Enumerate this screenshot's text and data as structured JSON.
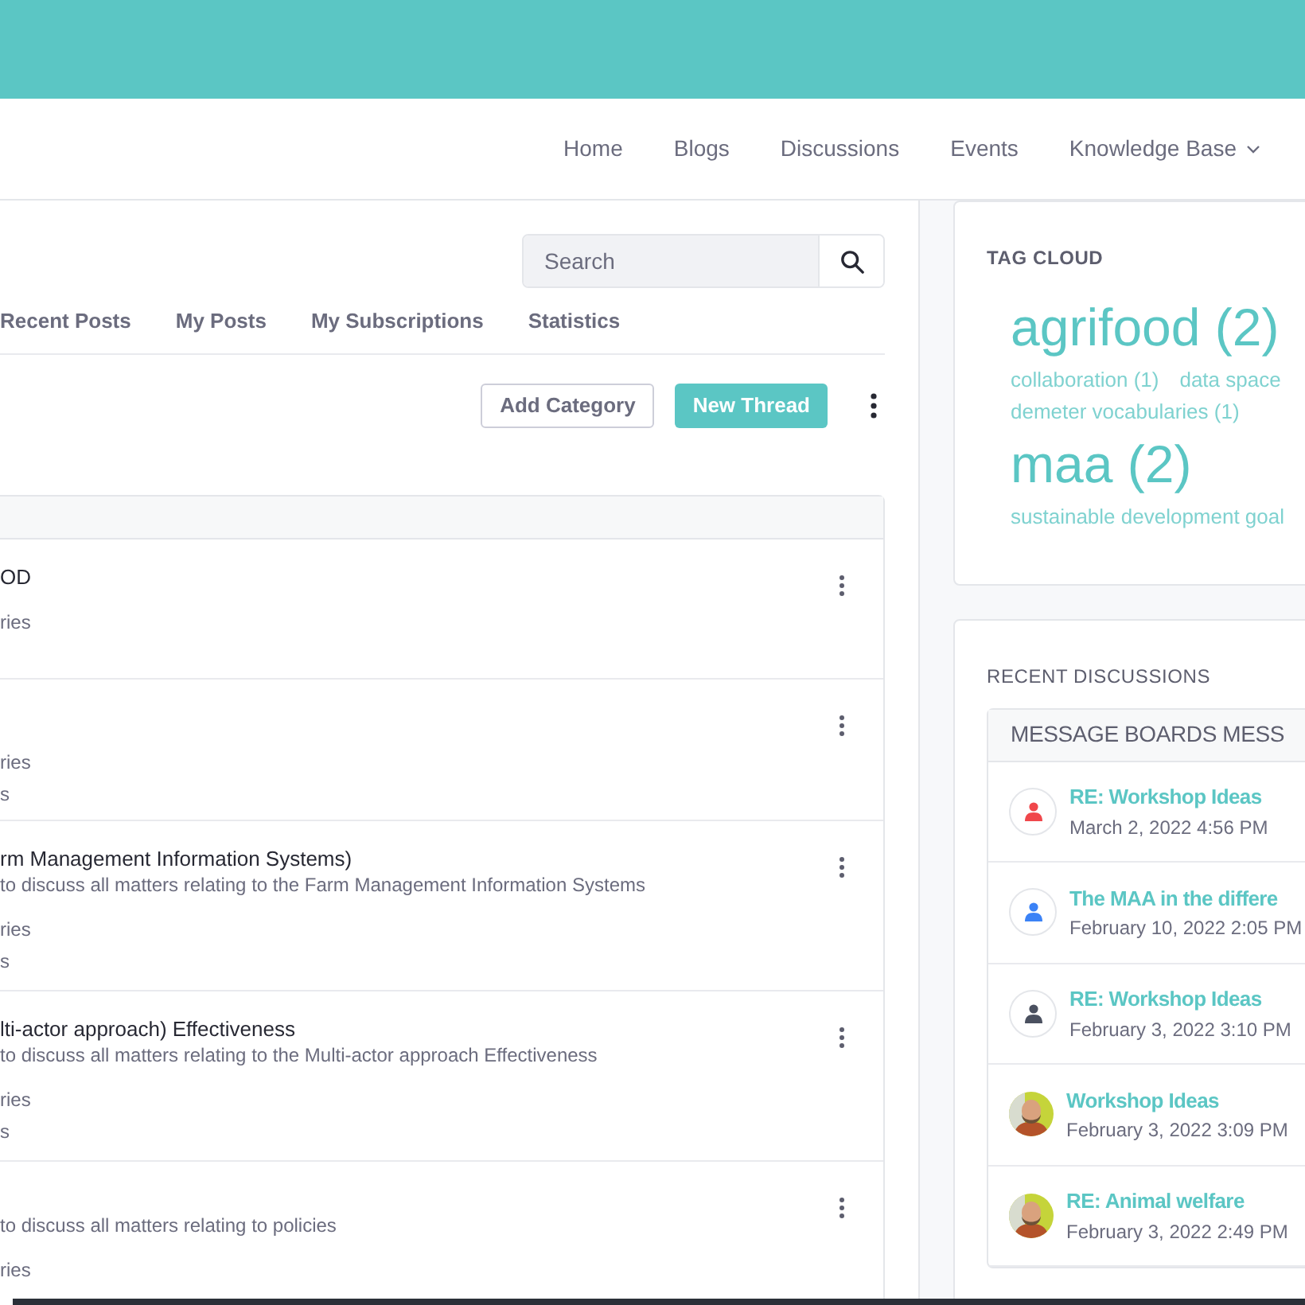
{
  "nav": {
    "items": [
      {
        "label": "Home"
      },
      {
        "label": "Blogs"
      },
      {
        "label": "Discussions"
      },
      {
        "label": "Events"
      },
      {
        "label": "Knowledge Base",
        "dropdown": true
      }
    ]
  },
  "board": {
    "search": {
      "placeholder": "Search"
    },
    "tabs": [
      {
        "label": "Recent Posts",
        "selected": false
      },
      {
        "label": "My Posts",
        "selected": false
      },
      {
        "label": "My Subscriptions",
        "selected": false
      },
      {
        "label": "Statistics",
        "selected": false
      }
    ],
    "buttons": [
      {
        "label": "Add Category",
        "kind": "outline"
      },
      {
        "label": "New Thread",
        "kind": "primary"
      }
    ],
    "rows": [
      {
        "title": "OD",
        "description": "",
        "lines": [
          "ries"
        ]
      },
      {
        "title": "",
        "description": "",
        "lines": [
          "ries",
          "s"
        ]
      },
      {
        "title": "rm Management Information Systems)",
        "description": "to discuss all matters relating to the Farm Management Information Systems",
        "lines": [
          "ries",
          "s"
        ]
      },
      {
        "title": "lti-actor approach) Effectiveness",
        "description": "to discuss all matters relating to the Multi-actor approach Effectiveness",
        "lines": [
          "ries",
          "s"
        ]
      },
      {
        "title": "",
        "description": "to discuss all matters relating to policies",
        "lines": [
          "ries"
        ]
      }
    ]
  },
  "tag_cloud": {
    "title": "TAG CLOUD",
    "tags": [
      {
        "label": "agrifood (2)",
        "kind": "large"
      },
      {
        "label": "collaboration (1)",
        "kind": "small"
      },
      {
        "label": "data space",
        "kind": "small"
      },
      {
        "label": "demeter vocabularies (1)",
        "kind": "small"
      },
      {
        "label": "maa (2)",
        "kind": "large"
      },
      {
        "label": "sustainable development goal",
        "kind": "small"
      }
    ]
  },
  "recent_discussions": {
    "title": "RECENT DISCUSSIONS",
    "table_header": "MESSAGE BOARDS MESS",
    "items": [
      {
        "title": "RE: Workshop Ideas",
        "date": "March 2, 2022 4:56 PM",
        "avatar": {
          "kind": "icon",
          "color": "#f0474b"
        }
      },
      {
        "title": "The MAA in the differe",
        "date": "February 10, 2022 2:05 PM",
        "avatar": {
          "kind": "icon",
          "color": "#3b82f6"
        }
      },
      {
        "title": "RE: Workshop Ideas",
        "date": "February 3, 2022 3:10 PM",
        "avatar": {
          "kind": "icon",
          "color": "#4b5160"
        }
      },
      {
        "title": "Workshop Ideas",
        "date": "February 3, 2022 3:09 PM"
      },
      {
        "title": "RE: Animal welfare",
        "date": "February 3, 2022 2:49 PM"
      }
    ]
  }
}
